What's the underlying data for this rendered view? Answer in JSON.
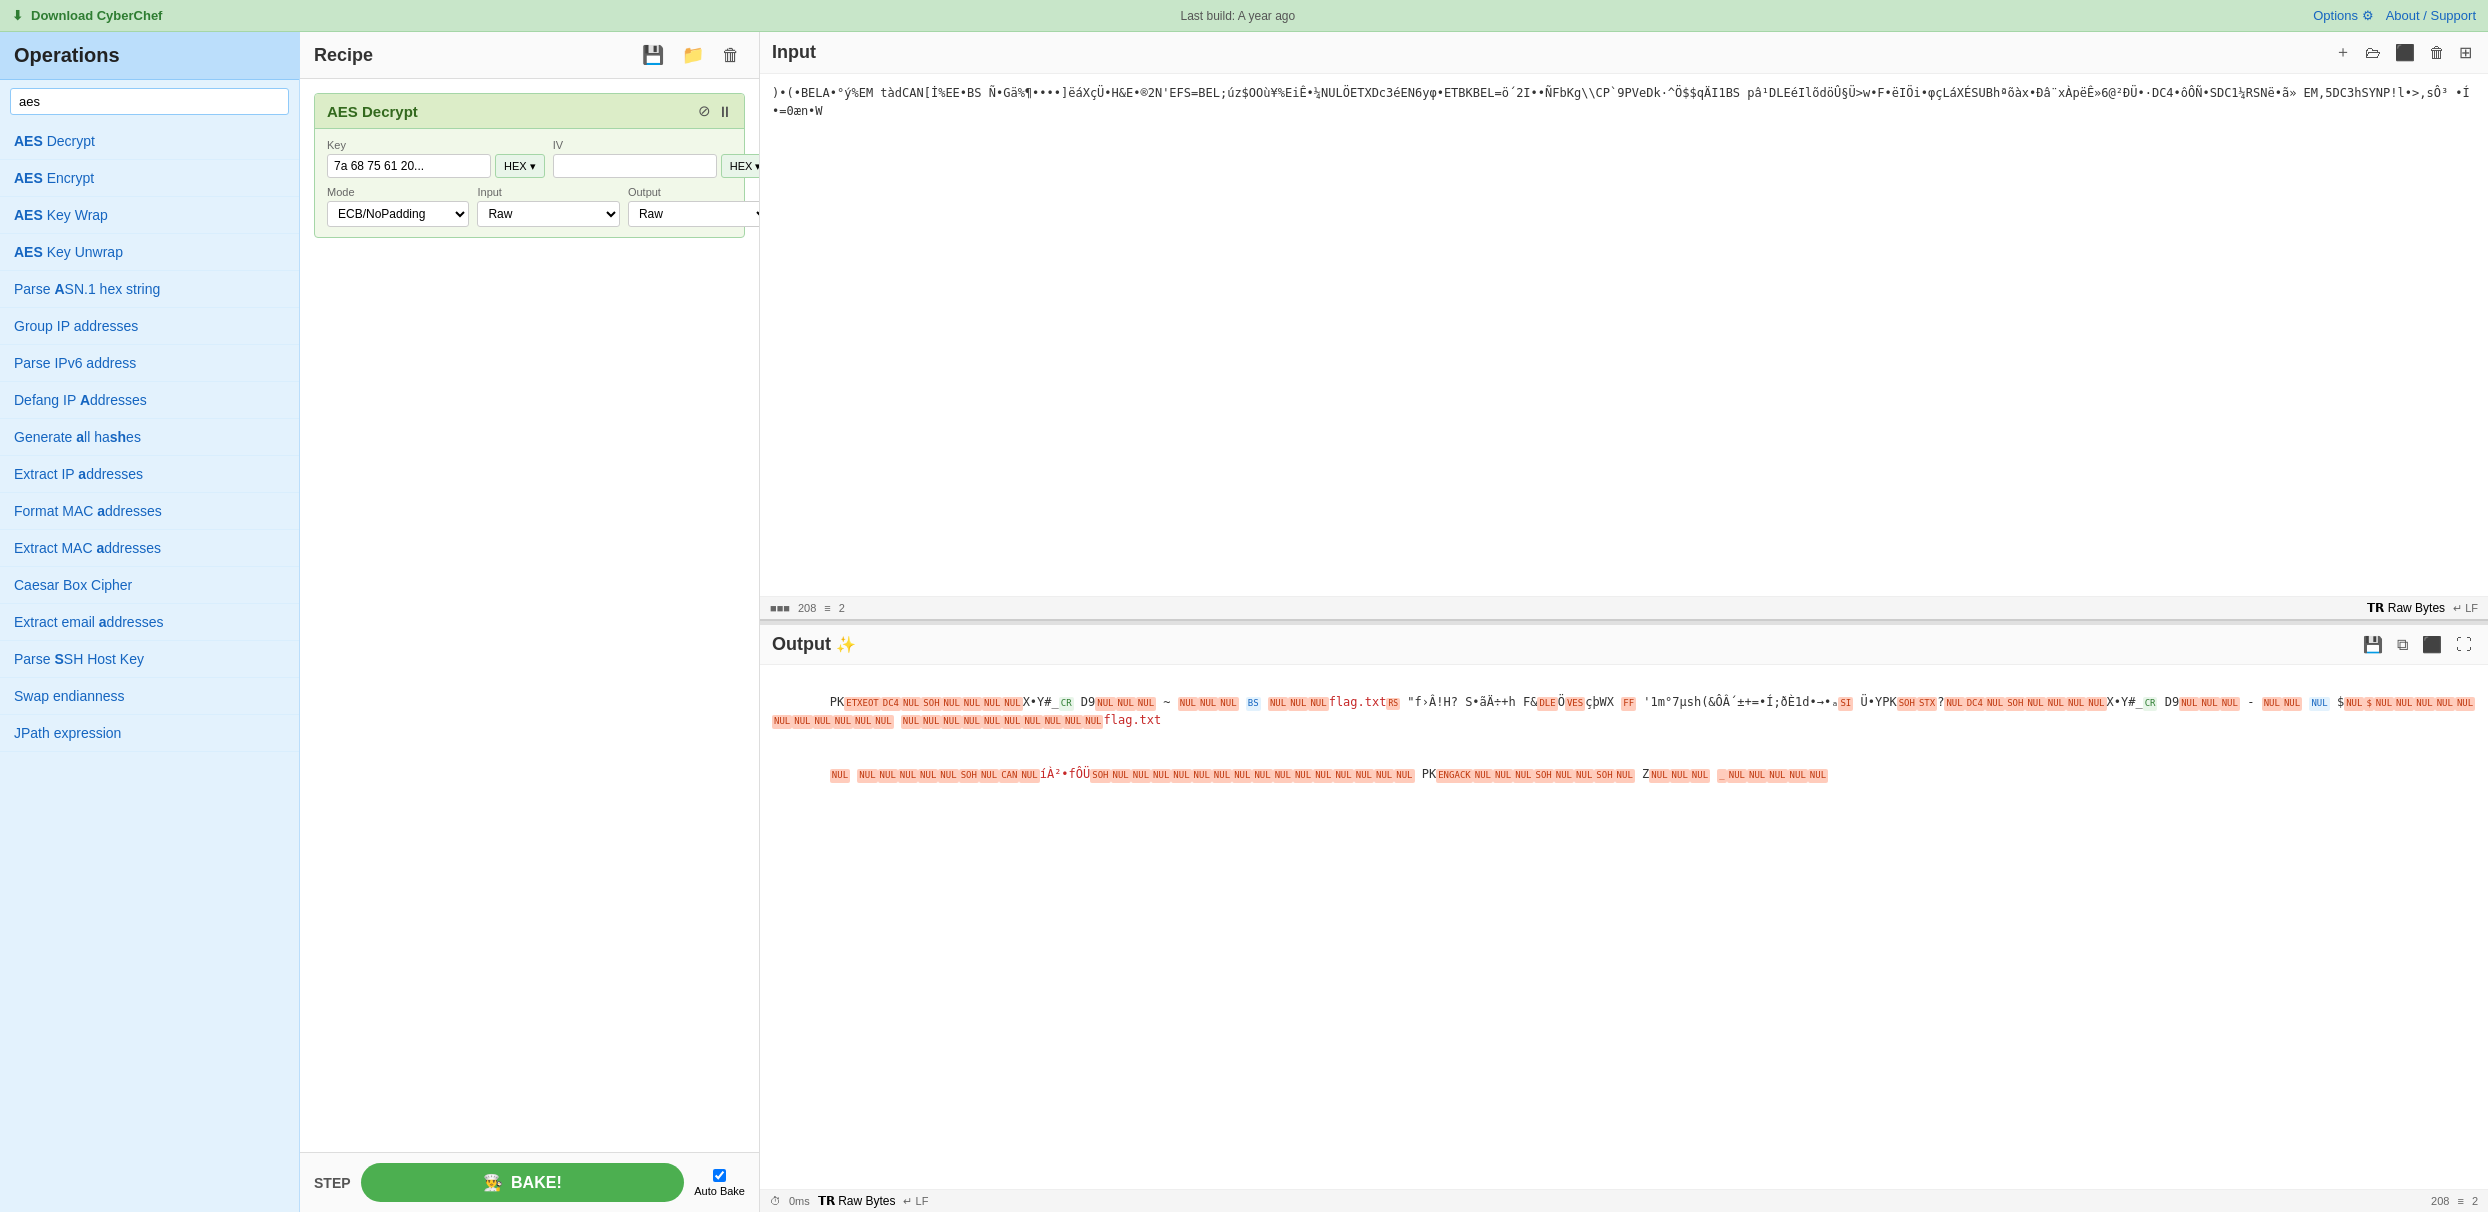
{
  "topbar": {
    "download_label": "Download CyberChef",
    "build_label": "Last build: A year ago",
    "options_label": "Options",
    "about_label": "About / Support"
  },
  "sidebar": {
    "title": "Operations",
    "search_placeholder": "aes",
    "items": [
      {
        "label": "AES Decrypt",
        "bold_part": "AES",
        "rest": " Decrypt"
      },
      {
        "label": "AES Encrypt",
        "bold_part": "AES",
        "rest": " Encrypt"
      },
      {
        "label": "AES Key Wrap",
        "bold_part": "AES",
        "rest": " Key Wrap"
      },
      {
        "label": "AES Key Unwrap",
        "bold_part": "AES",
        "rest": " Key Unwrap"
      },
      {
        "label": "Parse ASN.1 hex string",
        "bold_part": "A",
        "rest": "SN.1 hex string"
      },
      {
        "label": "Group IP addresses"
      },
      {
        "label": "Parse IPv6 address"
      },
      {
        "label": "Defang IP Addresses"
      },
      {
        "label": "Generate all hashes"
      },
      {
        "label": "Extract IP addresses"
      },
      {
        "label": "Format MAC addresses"
      },
      {
        "label": "Extract MAC addresses"
      },
      {
        "label": "Caesar Box Cipher"
      },
      {
        "label": "Extract email addresses"
      },
      {
        "label": "Parse SSH Host Key"
      },
      {
        "label": "Swap endianness"
      },
      {
        "label": "JPath expression"
      }
    ]
  },
  "recipe": {
    "title": "Recipe",
    "save_icon": "💾",
    "folder_icon": "📁",
    "trash_icon": "🗑",
    "operation": {
      "title": "AES Decrypt",
      "key_label": "Key",
      "key_value": "7a 68 75 61 20...",
      "key_format": "HEX",
      "iv_label": "IV",
      "iv_format": "HEX",
      "mode_label": "Mode",
      "mode_value": "ECB/NoPadding",
      "input_label": "Input",
      "input_value": "Raw",
      "output_label": "Output",
      "output_value": "Raw"
    }
  },
  "footer": {
    "step_label": "STEP",
    "bake_label": "BAKE!",
    "auto_bake_label": "Auto Bake"
  },
  "input": {
    "title": "Input",
    "content": ")•(•BELA•°ý%EM tàdCAN[İ%EE•BS Ñ•Gä%¶••••]ëáXçÜ•H&E•®2N'EFS=BEL;úz$OOù¥%EiÊ•¼NULÖETXDc3éEN6yφ•ETBKBEL=ö´2I••ÑFbKg\\CP`9PVeDk·^Ö$$qÄI1BS pâ¹DLEéIlõdöÛ§Ü>w•F•ëIÖi•φçLáXÉSUBhªõàx•Ðâ¨xÀpëÊ»6@²ÐÜ•·DC4•ôÔÑ•SDC1¼RSN욕ë•ãRS EM,5DC3hSYNP!l•>,sÔ³ •Í•=0æn•W",
    "stats": {
      "bytes": "208",
      "lines": "2"
    },
    "format": "Raw Bytes",
    "line_ending": "LF"
  },
  "output": {
    "title": "Output",
    "stats": {
      "bytes": "208",
      "lines": "2"
    },
    "format": "Raw Bytes",
    "line_ending": "LF",
    "time": "0ms"
  }
}
